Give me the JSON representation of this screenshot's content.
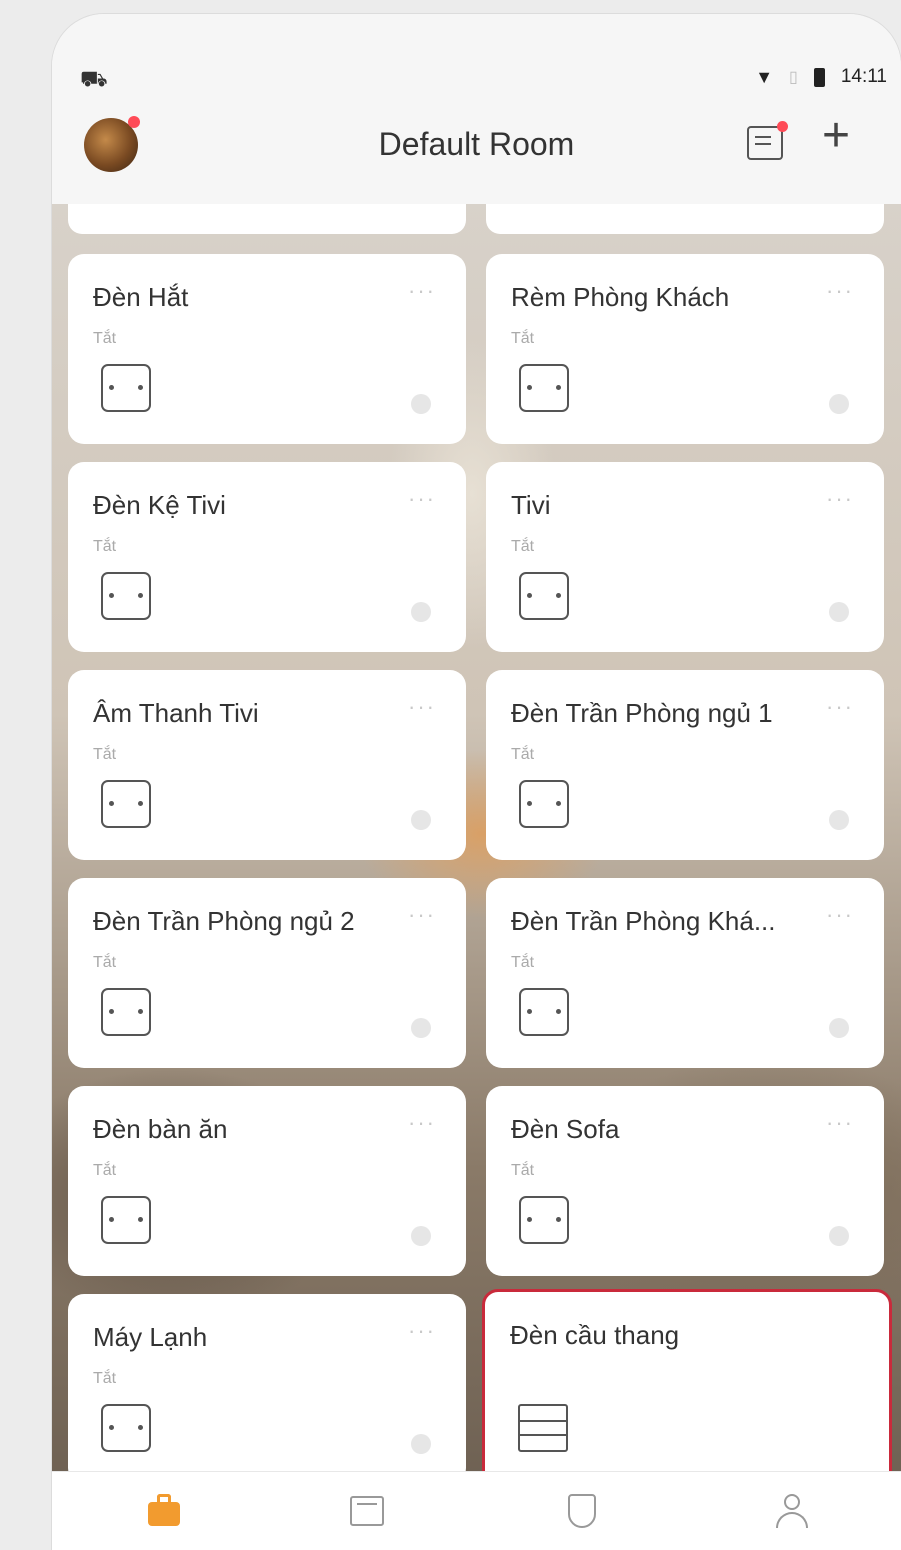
{
  "status_bar": {
    "time": "14:11"
  },
  "header": {
    "title": "Default Room"
  },
  "devices": [
    {
      "name": "Đèn Hắt",
      "status": "Tắt"
    },
    {
      "name": "Rèm Phòng Khách",
      "status": "Tắt"
    },
    {
      "name": "Đèn Kệ Tivi",
      "status": "Tắt"
    },
    {
      "name": "Tivi",
      "status": "Tắt"
    },
    {
      "name": "Âm Thanh Tivi",
      "status": "Tắt"
    },
    {
      "name": "Đèn Trần Phòng ngủ 1",
      "status": "Tắt"
    },
    {
      "name": "Đèn Trần Phòng ngủ 2",
      "status": "Tắt"
    },
    {
      "name": "Đèn Trần Phòng Khá...",
      "status": "Tắt"
    },
    {
      "name": "Đèn bàn ăn",
      "status": "Tắt"
    },
    {
      "name": "Đèn Sofa",
      "status": "Tắt"
    },
    {
      "name": "Máy Lạnh",
      "status": "Tắt"
    },
    {
      "name": "Đèn cầu thang",
      "status": ""
    }
  ],
  "more_symbol": "···",
  "accent_color": "#f29b2f",
  "selected_border_color": "#c92a3b",
  "tabs": [
    {
      "icon": "home-icon"
    },
    {
      "icon": "scene-icon"
    },
    {
      "icon": "shield-icon"
    },
    {
      "icon": "profile-icon"
    }
  ]
}
